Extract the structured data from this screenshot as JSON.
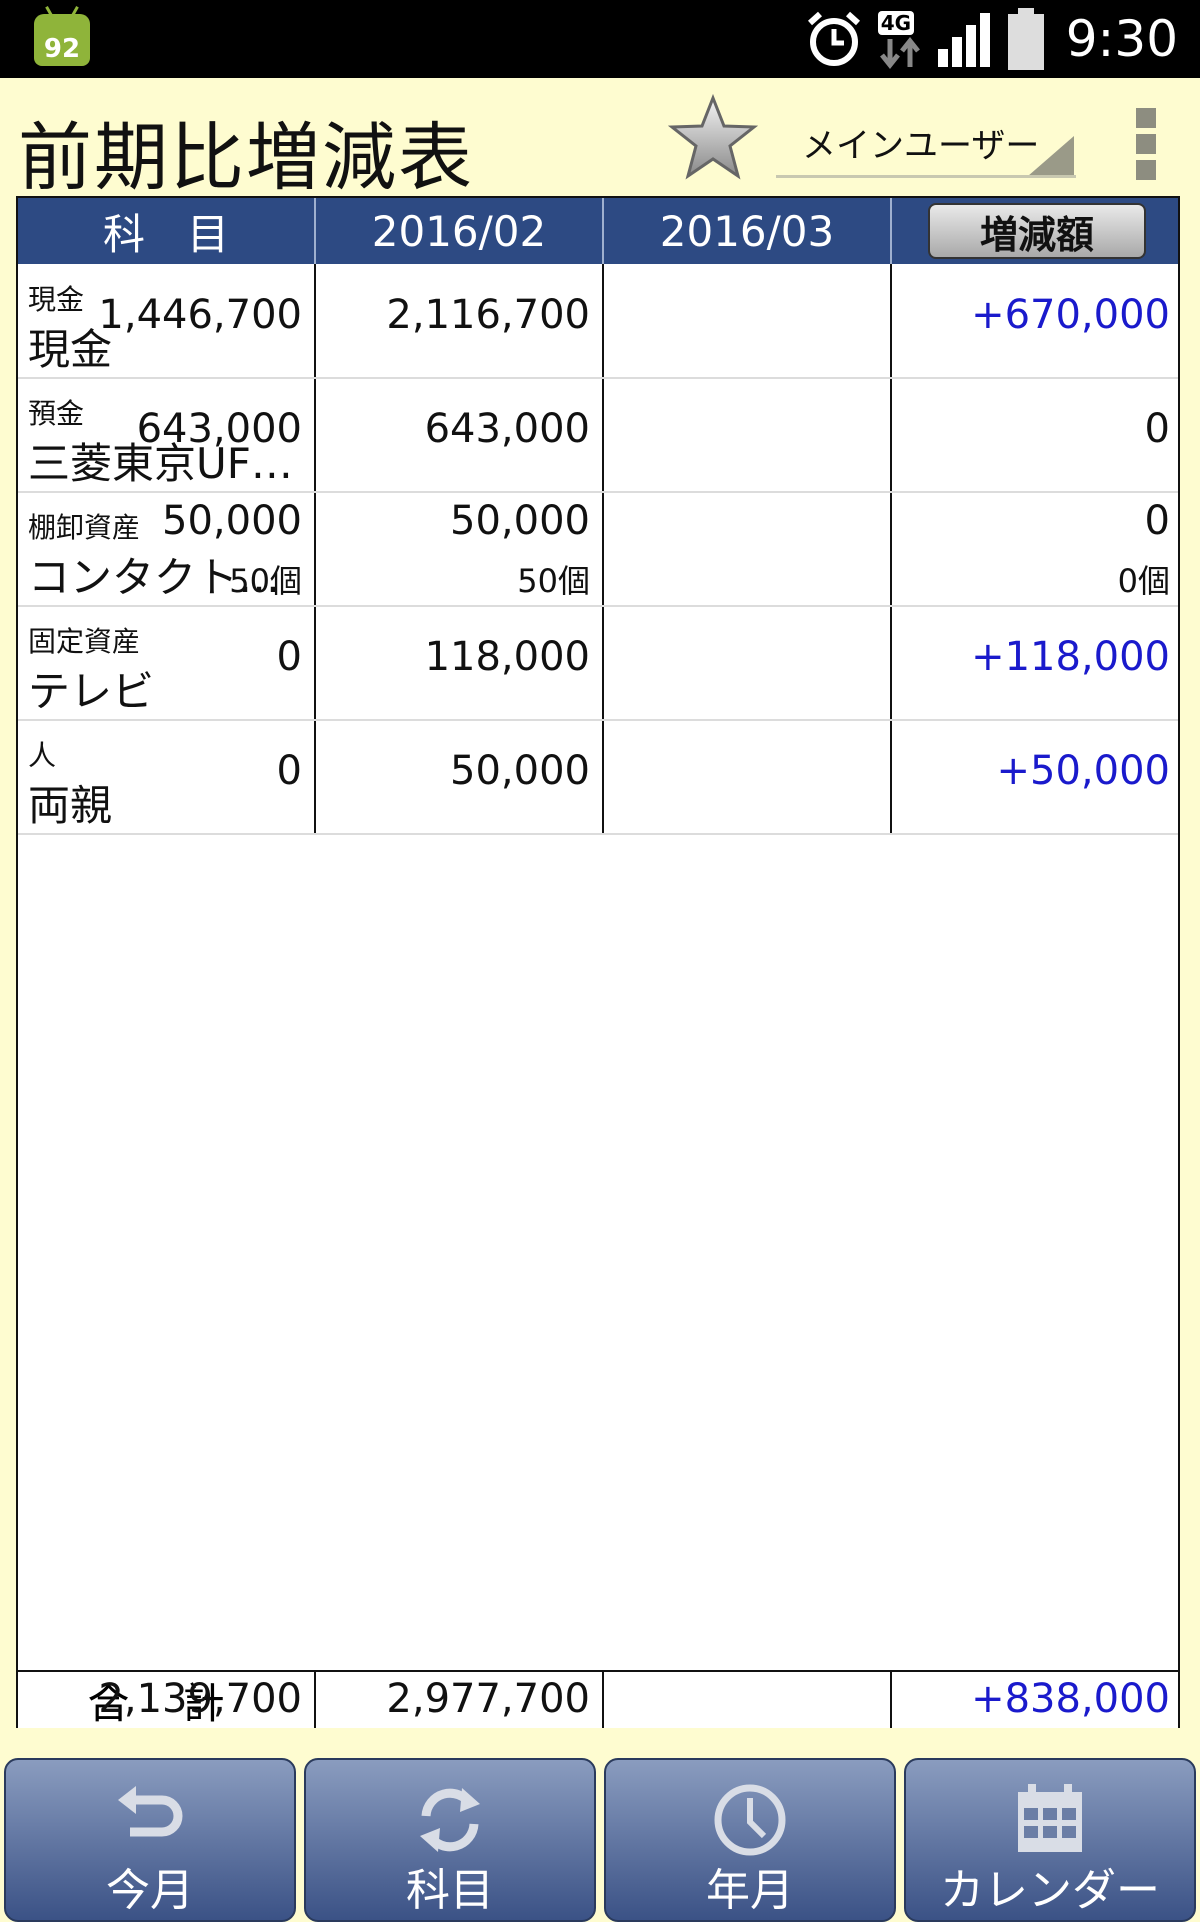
{
  "status_bar": {
    "badge": "92",
    "network": "4G",
    "time": "9:30"
  },
  "header": {
    "title": "前期比増減表",
    "user": "メインユーザー"
  },
  "table": {
    "headers": {
      "subject": "科　目",
      "col1": "2016/02",
      "col2": "2016/03",
      "diff": "増減額"
    },
    "rows": [
      {
        "category": "現金",
        "name": "現金",
        "v1": "1,446,700",
        "v2": "2,116,700",
        "diff": "+670,000",
        "diff_positive": true
      },
      {
        "category": "預金",
        "name": "三菱東京UF…",
        "v1": "643,000",
        "v2": "643,000",
        "diff": "0",
        "diff_positive": false
      },
      {
        "category": "棚卸資産",
        "name": "コンタクト…",
        "v1": "50,000",
        "v2": "50,000",
        "diff": "0",
        "diff_positive": false,
        "q1": "50個",
        "q2": "50個",
        "qd": "0個"
      },
      {
        "category": "固定資産",
        "name": "テレビ",
        "v1": "0",
        "v2": "118,000",
        "diff": "+118,000",
        "diff_positive": true
      },
      {
        "category": "人",
        "name": "両親",
        "v1": "0",
        "v2": "50,000",
        "diff": "+50,000",
        "diff_positive": true
      }
    ],
    "total": {
      "label": "合 計",
      "v1": "2,139,700",
      "v2": "2,977,700",
      "diff": "+838,000"
    }
  },
  "bottom_nav": [
    {
      "label": "今月",
      "icon": "undo-arrow-icon"
    },
    {
      "label": "科目",
      "icon": "refresh-icon"
    },
    {
      "label": "年月",
      "icon": "clock-icon"
    },
    {
      "label": "カレンダー",
      "icon": "calendar-icon"
    }
  ],
  "colors": {
    "header_bg": "#2d4a83",
    "positive": "#1a1acc",
    "page_bg": "#fefcd0"
  }
}
